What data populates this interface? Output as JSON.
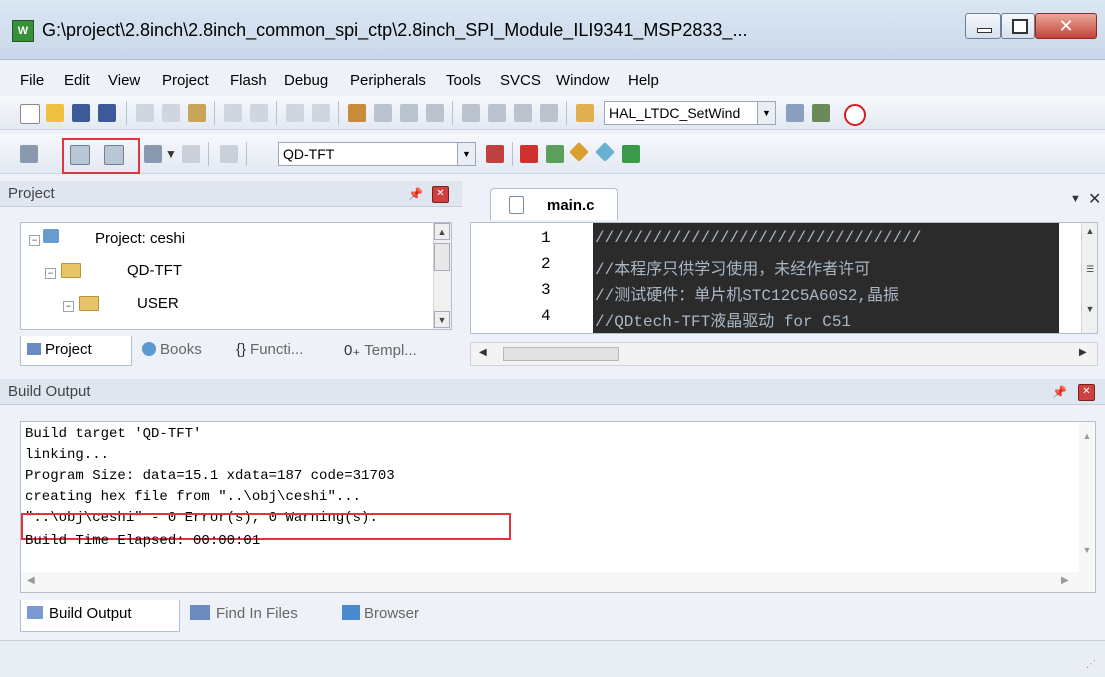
{
  "window": {
    "title": "G:\\project\\2.8inch\\2.8inch_common_spi_ctp\\2.8inch_SPI_Module_ILI9341_MSP2833_...",
    "app_icon_text": "W"
  },
  "menu": [
    "File",
    "Edit",
    "View",
    "Project",
    "Flash",
    "Debug",
    "Peripherals",
    "Tools",
    "SVCS",
    "Window",
    "Help"
  ],
  "toolbar": {
    "find_combo": "HAL_LTDC_SetWind",
    "target_combo": "QD-TFT"
  },
  "project_panel": {
    "header": "Project",
    "tree": [
      {
        "label": "Project: ceshi"
      },
      {
        "label": "QD-TFT"
      },
      {
        "label": "USER"
      }
    ],
    "tabs": [
      "Project",
      "Books",
      "Functi...",
      "Templ..."
    ]
  },
  "editor": {
    "tab_title": "main.c",
    "line_numbers": [
      "1",
      "2",
      "3",
      "4"
    ],
    "lines": [
      "//////////////////////////////////",
      "//本程序只供学习使用，未经作者许可",
      "//测试硬件：单片机STC12C5A60S2,晶振",
      "//QDtech-TFT液晶驱动 for C51"
    ]
  },
  "build_output": {
    "header": "Build Output",
    "lines": [
      "Build target 'QD-TFT'",
      "linking...",
      "Program Size: data=15.1 xdata=187 code=31703",
      "creating hex file from \"..\\obj\\ceshi\"...",
      "\"..\\obj\\ceshi\" - 0 Error(s), 0 Warning(s).",
      "Build Time Elapsed:  00:00:01"
    ],
    "tabs": [
      "Build Output",
      "Find In Files",
      "Browser"
    ]
  },
  "colors": {
    "highlight": "#e2343c",
    "code_bg": "#2b2b2b"
  }
}
